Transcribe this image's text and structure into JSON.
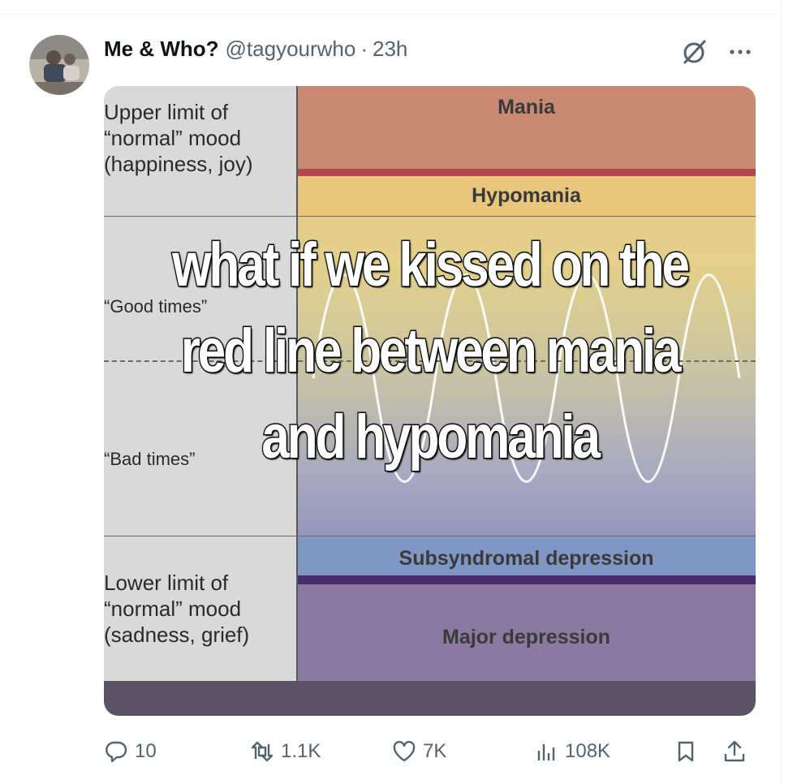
{
  "tweet": {
    "display_name": "Me & Who?",
    "handle": "@tagyourwho",
    "separator": "·",
    "time": "23h"
  },
  "icons": {
    "avatar": "avatar",
    "grok": "grok-icon",
    "more": "more-icon",
    "reply": "reply-icon",
    "retweet": "retweet-icon",
    "like": "like-icon",
    "views": "views-icon",
    "bookmark": "bookmark-icon",
    "share": "share-icon"
  },
  "media": {
    "left_labels": {
      "upper": "Upper limit of\n“normal” mood\n(happiness, joy)",
      "good": "“Good times”",
      "bad": "“Bad times”",
      "lower": "Lower limit of\n“normal” mood\n(sadness, grief)"
    },
    "bands": {
      "mania": "Mania",
      "hypomania": "Hypomania",
      "subsyndromal": "Subsyndromal depression",
      "major": "Major depression"
    },
    "overlay_text": {
      "line1": "what if we kissed on the",
      "line2": "red line between mania",
      "line3": "and hypomania"
    }
  },
  "actions": {
    "replies": "10",
    "retweets": "1.1K",
    "likes": "7K",
    "views": "108K"
  },
  "colors": {
    "text_primary": "#0f1419",
    "text_secondary": "#536471",
    "mania": "#c98a74",
    "red_line": "#b5474a",
    "hypomania": "#e8c77d",
    "subsyndromal": "#7f97c4",
    "major": "#8b7aa0"
  }
}
